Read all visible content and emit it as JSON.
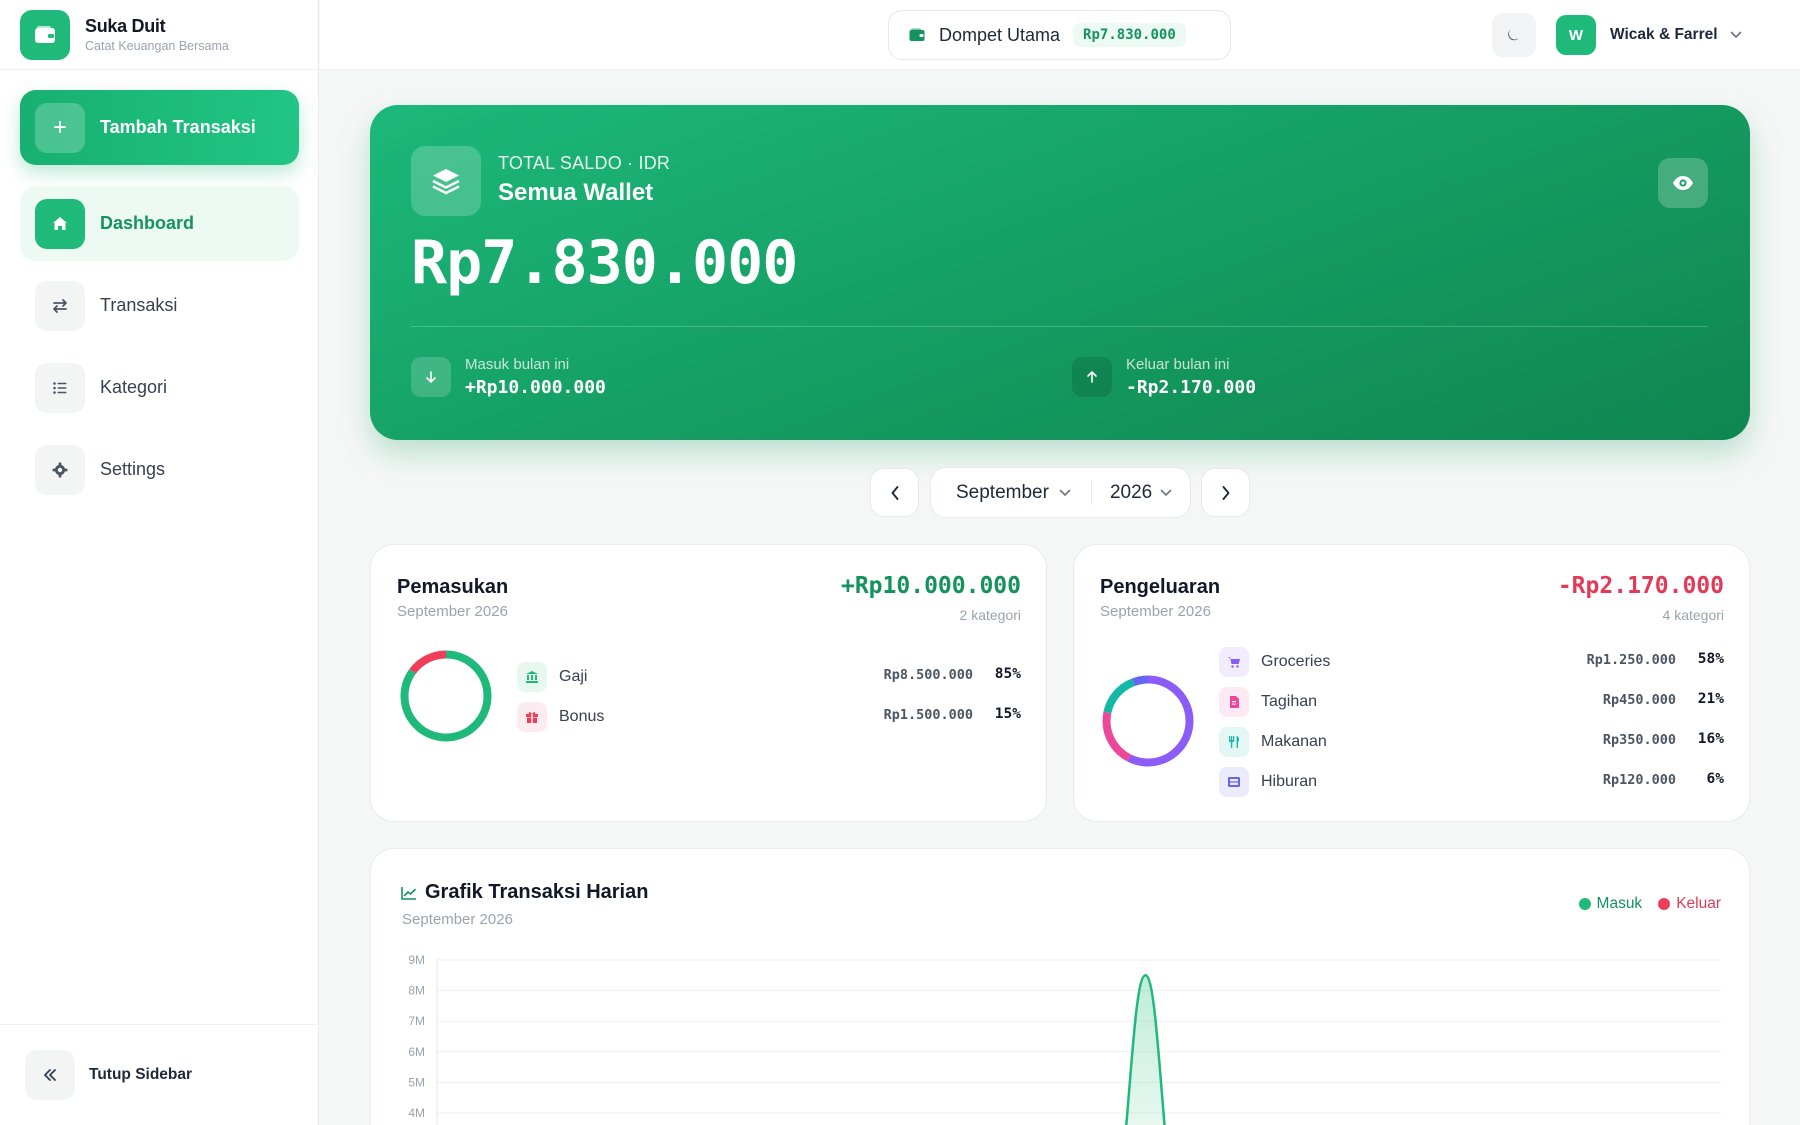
{
  "brand": {
    "title": "Suka Duit",
    "subtitle": "Catat Keuangan Bersama"
  },
  "sidebar": {
    "add_label": "Tambah Transaksi",
    "items": [
      {
        "label": "Dashboard",
        "icon": "home-icon",
        "active": true
      },
      {
        "label": "Transaksi",
        "icon": "swap-icon",
        "active": false
      },
      {
        "label": "Kategori",
        "icon": "list-icon",
        "active": false
      },
      {
        "label": "Settings",
        "icon": "gear-icon",
        "active": false
      }
    ],
    "collapse_label": "Tutup Sidebar"
  },
  "header": {
    "wallet_name": "Dompet Utama",
    "wallet_balance": "Rp7.830.000",
    "user_initial": "W",
    "user_name": "Wicak & Farrel"
  },
  "hero": {
    "caption": "TOTAL SALDO · IDR",
    "wallet_label": "Semua Wallet",
    "balance": "Rp7.830.000",
    "income_caption": "Masuk bulan ini",
    "income_value": "+Rp10.000.000",
    "expense_caption": "Keluar bulan ini",
    "expense_value": "-Rp2.170.000"
  },
  "period": {
    "month": "September",
    "year": "2026"
  },
  "income_card": {
    "title": "Pemasukan",
    "subtitle": "September 2026",
    "total": "+Rp10.000.000",
    "count": "2 kategori",
    "items": [
      {
        "name": "Gaji",
        "amount": "Rp8.500.000",
        "pct": "85%",
        "share": 85,
        "color": "#1fb97a",
        "bg": "#e8f8f0",
        "icon": "bank-icon"
      },
      {
        "name": "Bonus",
        "amount": "Rp1.500.000",
        "pct": "15%",
        "share": 15,
        "color": "#ef3e5c",
        "bg": "#fdecef",
        "icon": "gift-icon"
      }
    ]
  },
  "expense_card": {
    "title": "Pengeluaran",
    "subtitle": "September 2026",
    "total": "-Rp2.170.000",
    "count": "4 kategori",
    "items": [
      {
        "name": "Groceries",
        "amount": "Rp1.250.000",
        "pct": "58%",
        "share": 58,
        "color": "#8b5cf6",
        "bg": "#f1ecfe",
        "icon": "cart-icon"
      },
      {
        "name": "Tagihan",
        "amount": "Rp450.000",
        "pct": "21%",
        "share": 21,
        "color": "#ec4899",
        "bg": "#fdeaf4",
        "icon": "bill-icon"
      },
      {
        "name": "Makanan",
        "amount": "Rp350.000",
        "pct": "16%",
        "share": 16,
        "color": "#14b8a6",
        "bg": "#e4f7f4",
        "icon": "utensils-icon"
      },
      {
        "name": "Hiburan",
        "amount": "Rp120.000",
        "pct": "6%",
        "share": 6,
        "color": "#6366f1",
        "bg": "#ecebfd",
        "icon": "film-icon"
      }
    ]
  },
  "daily_chart": {
    "title": "Grafik Transaksi Harian",
    "subtitle": "September 2026",
    "legend_in": "Masuk",
    "legend_out": "Keluar",
    "color_in": "#1fb97a",
    "color_out": "#ef3e5c"
  },
  "chart_data": {
    "type": "area",
    "x_range": [
      1,
      30
    ],
    "y_ticks": [
      "9M",
      "8M",
      "7M",
      "6M",
      "5M",
      "4M"
    ],
    "ylim": [
      0,
      9
    ],
    "series": [
      {
        "name": "Masuk",
        "peak_day": 17,
        "peak_value": 8.5
      },
      {
        "name": "Keluar",
        "values": []
      }
    ],
    "legend": "top-right",
    "grid": true
  },
  "colors": {
    "accent": "#1fb97a",
    "income": "#15935f",
    "expense": "#e23b5a"
  }
}
